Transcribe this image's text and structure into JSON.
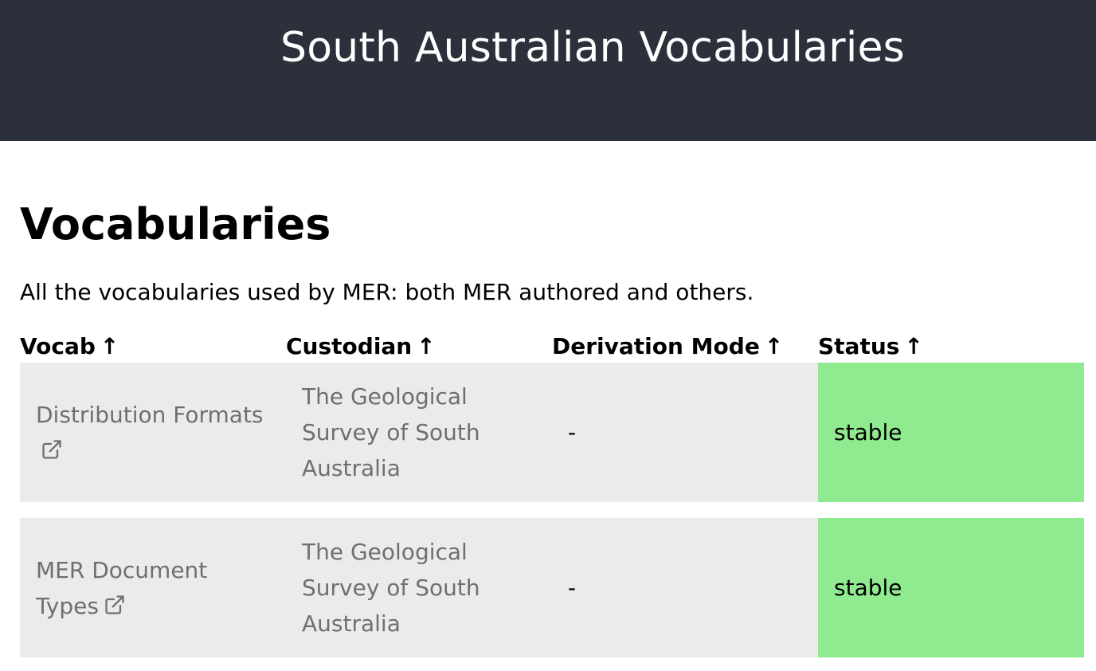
{
  "header": {
    "site_title": "South Australian Vocabularies",
    "background_color": "#2b303b"
  },
  "main": {
    "title": "Vocabularies",
    "description": "All the vocabularies used by MER: both MER authored and others."
  },
  "table": {
    "columns": [
      {
        "label": "Vocab",
        "sort_icon": "↑"
      },
      {
        "label": "Custodian",
        "sort_icon": "↑"
      },
      {
        "label": "Derivation Mode",
        "sort_icon": "↑"
      },
      {
        "label": "Status",
        "sort_icon": "↑"
      }
    ],
    "rows": [
      {
        "vocab": "Distribution Formats",
        "vocab_icon": "external-link-icon",
        "custodian": "The Geological Survey of South Australia",
        "derivation_mode": "-",
        "status": "stable"
      },
      {
        "vocab": "MER Document Types",
        "vocab_icon": "external-link-icon",
        "custodian": "The Geological Survey of South Australia",
        "derivation_mode": "-",
        "status": "stable"
      }
    ],
    "status_color": "#90ea8f",
    "row_color": "#ebebeb"
  }
}
